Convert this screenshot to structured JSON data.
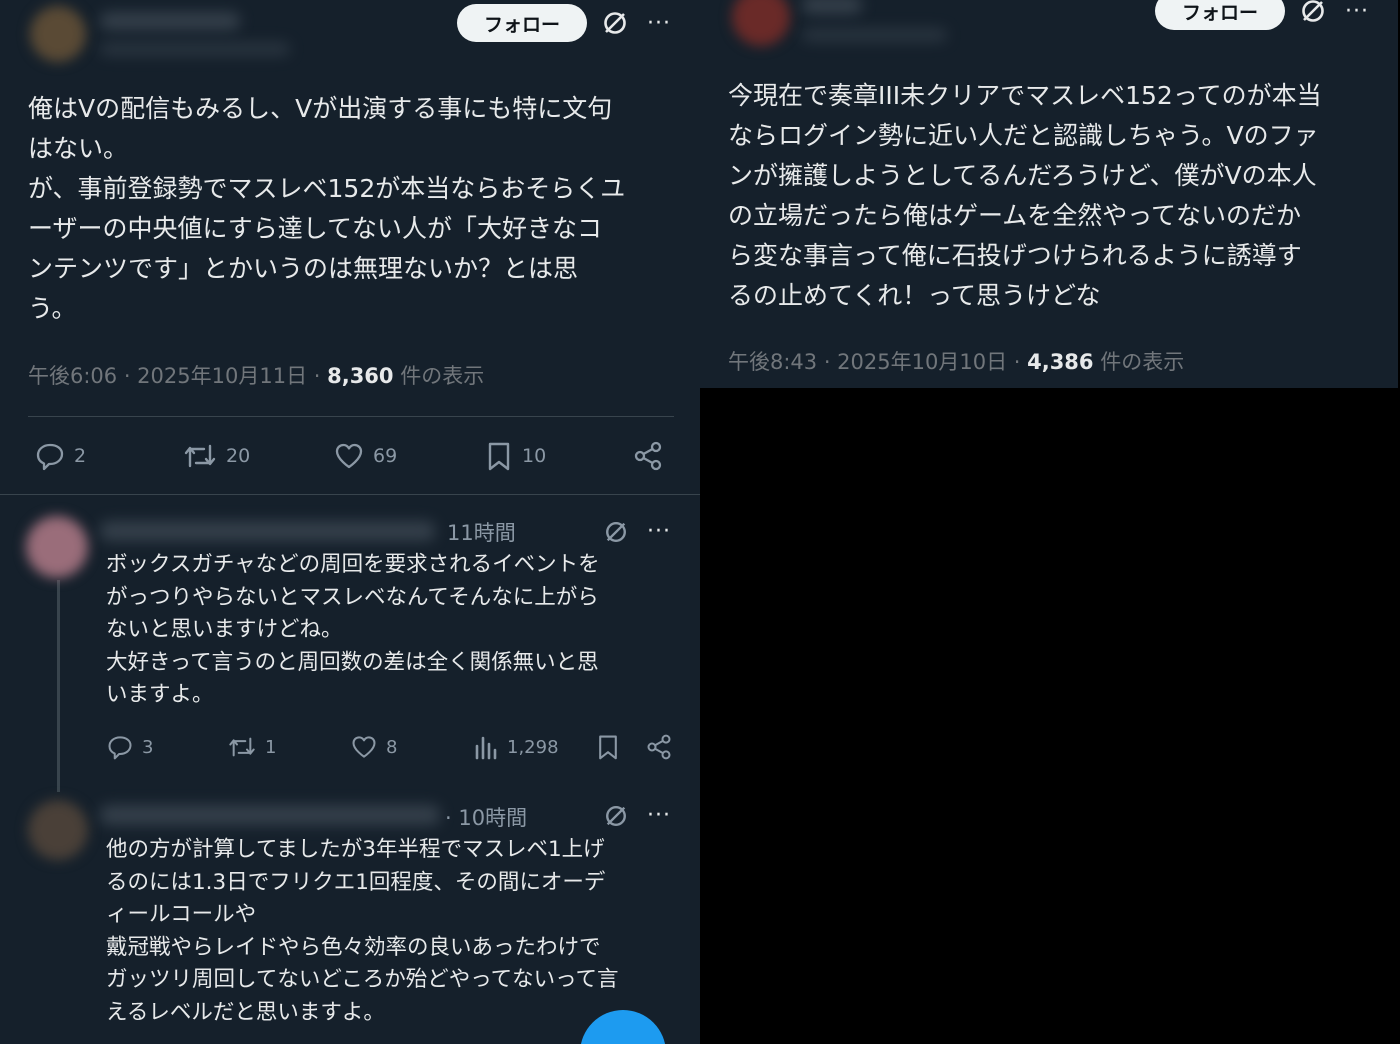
{
  "left_post": {
    "follow_label": "フォロー",
    "more_label": "···",
    "text": "俺はVの配信もみるし、Vが出演する事にも特に文句\nはない。\nが、事前登録勢でマスレベ152が本当ならおそらくユ\nーザーの中央値にすら達してない人が「大好きなコ\nンテンツです」とかいうのは無理ないか？とは思\nう。",
    "timestamp": "午後6:06 · 2025年10月11日 · ",
    "views_count": "8,360",
    "views_label": " 件の表示",
    "reply_count": "2",
    "retweet_count": "20",
    "like_count": "69",
    "bookmark_count": "10"
  },
  "replies": [
    {
      "time": "11時間",
      "text": "ボックスガチャなどの周回を要求されるイベントを\nがっつりやらないとマスレベなんてそんなに上がら\nないと思いますけどね。\n大好きって言うのと周回数の差は全く関係無いと思\nいますよ。",
      "reply_count": "3",
      "retweet_count": "1",
      "like_count": "8",
      "view_count": "1,298"
    },
    {
      "time": "· 10時間",
      "text": "他の方が計算してましたが3年半程でマスレベ1上げ\nるのには1.3日でフリクエ1回程度、その間にオーデ\nィールコールや\n戴冠戦やらレイドやら色々効率の良いあったわけで\nガッツリ周回してないどころか殆どやってないって言\nえるレベルだと思いますよ。"
    }
  ],
  "right_post": {
    "follow_label": "フォロー",
    "more_label": "···",
    "text": "今現在で奏章III未クリアでマスレベ152ってのが本当\nならログイン勢に近い人だと認識しちゃう。Vのファ\nンが擁護しようとしてるんだろうけど、僕がVの本人\nの立場だったら俺はゲームを全然やってないのだか\nら変な事言って俺に石投げつけられるように誘導す\nるの止めてくれ！って思うけどな",
    "timestamp": "午後8:43 · 2025年10月10日 · ",
    "views_count": "4,386",
    "views_label": " 件の表示"
  },
  "colors": {
    "background": "#15202b",
    "outer": "#000000",
    "text": "#e7e9ea",
    "muted": "#71767b",
    "accent": "#1d9bf0"
  },
  "icons": [
    "grok-icon",
    "more-icon",
    "reply-icon",
    "retweet-icon",
    "like-icon",
    "bookmark-icon",
    "share-icon",
    "views-icon"
  ]
}
